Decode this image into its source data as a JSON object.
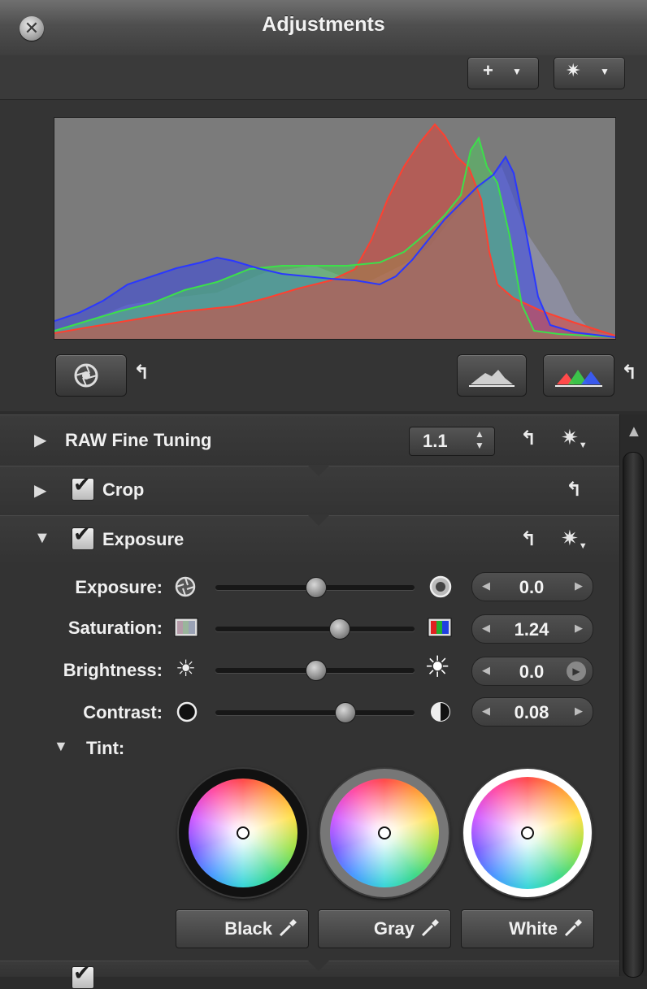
{
  "window": {
    "title": "Adjustments"
  },
  "toolbar": {
    "add_label": "+",
    "action_label": "✷"
  },
  "histogram": {
    "colors": {
      "red": "#e0453a",
      "green": "#4ad65a",
      "blue": "#3a48e8",
      "overlap": "#9aa0b8",
      "background": "#7b7b7b"
    }
  },
  "sections": {
    "raw": {
      "label": "RAW Fine Tuning",
      "version": "1.1"
    },
    "crop": {
      "label": "Crop",
      "checked": true
    },
    "exposure": {
      "label": "Exposure",
      "checked": true,
      "sliders": [
        {
          "label": "Exposure:",
          "value": "0.0",
          "position": 0.5
        },
        {
          "label": "Saturation:",
          "value": "1.24",
          "position": 0.62
        },
        {
          "label": "Brightness:",
          "value": "0.0",
          "position": 0.5
        },
        {
          "label": "Contrast:",
          "value": "0.08",
          "position": 0.65
        }
      ],
      "tint": {
        "label": "Tint:",
        "buttons": [
          "Black",
          "Gray",
          "White"
        ]
      }
    }
  },
  "colors": {
    "accent": "#2c2c2c",
    "panel": "#333333",
    "text": "#f0f0f0"
  }
}
